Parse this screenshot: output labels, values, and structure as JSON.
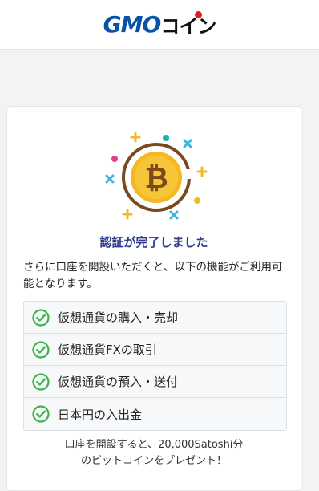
{
  "header": {
    "logo_gmo": "GMO",
    "logo_coin": "コイン"
  },
  "verification": {
    "title": "認証が完了しました",
    "description": "さらに口座を開設いただくと、以下の機能がご利用可能となります。"
  },
  "features": [
    {
      "label": "仮想通貨の購入・売却"
    },
    {
      "label": "仮想通貨FXの取引"
    },
    {
      "label": "仮想通貨の預入・送付"
    },
    {
      "label": "日本円の入出金"
    }
  ],
  "bonus": {
    "line1": "口座を開設すると、20,000Satoshi分",
    "line2": "のビットコインをプレゼント！"
  },
  "icons": {
    "feature": "check-circle-icon",
    "illustration": "bitcoin-coin-icon"
  },
  "colors": {
    "brand_blue": "#0a52a8",
    "title_navy": "#2d3b8a",
    "check_green": "#3cb44b",
    "coin_gold": "#f5b820",
    "coin_brown": "#7a4a1c"
  }
}
